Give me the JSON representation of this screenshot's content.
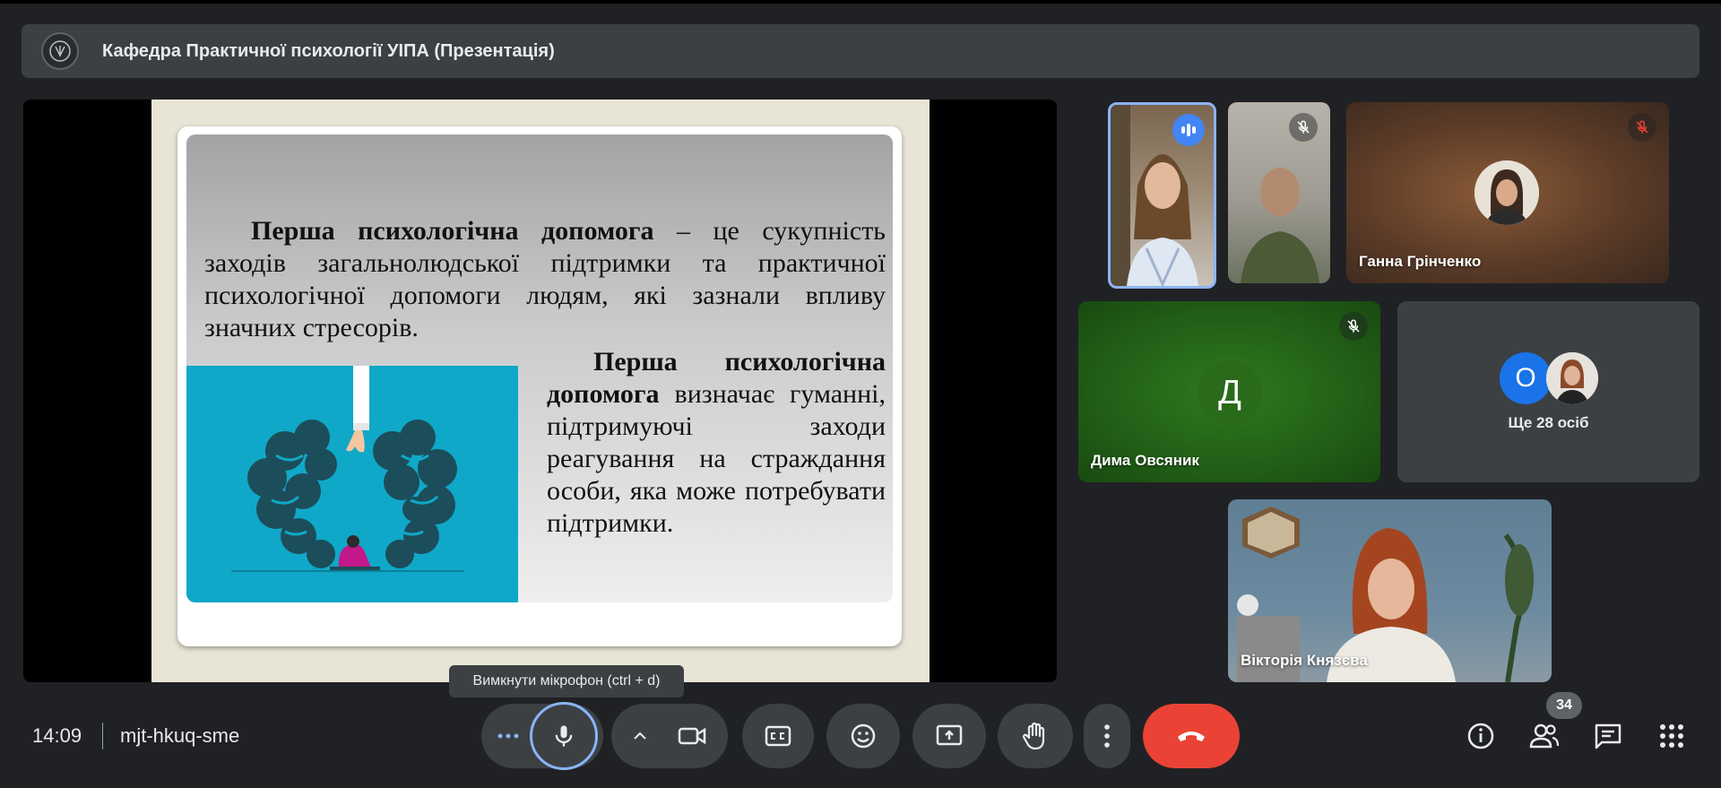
{
  "presentation": {
    "title": "Кафедра Практичної психології УІПА (Презентація)"
  },
  "slide": {
    "para1_bold": "Перша психологічна допомога",
    "para1_rest": " – це сукупність заходів загальнолюдської підтримки та практичної психологічної допомоги людям, які зазнали впливу значних стресорів.",
    "para2_bold": "Перша психологічна допомога",
    "para2_rest": " визначає гуманні, підтримуючі заходи реагування на страждання особи, яка може потребувати підтримки."
  },
  "participants": {
    "ganna": {
      "name": "Ганна Грінченко"
    },
    "dyma": {
      "name": "Дима Овсяник",
      "initial": "Д"
    },
    "others": {
      "initial": "О",
      "label": "Ще 28 осіб"
    },
    "viktoria": {
      "name": "Вікторія Князєва"
    }
  },
  "tooltip": {
    "text": "Вимкнути мікрофон (ctrl + d)"
  },
  "meeting": {
    "time": "14:09",
    "code": "mjt-hkuq-sme",
    "participant_count": "34"
  },
  "colors": {
    "end_call": "#ea4335",
    "speaking": "#4285f4",
    "mic_ring": "#8ab4f8",
    "slide_teal": "#10a8c8",
    "dyma_tile": "#1f5a15"
  },
  "icons": [
    "more-options-icon",
    "microphone-icon",
    "chevron-up-icon",
    "camera-icon",
    "captions-icon",
    "emoji-icon",
    "present-icon",
    "raise-hand-icon",
    "more-vert-icon",
    "end-call-icon",
    "info-icon",
    "people-icon",
    "chat-icon",
    "apps-icon",
    "mic-off-icon",
    "speaking-icon"
  ]
}
